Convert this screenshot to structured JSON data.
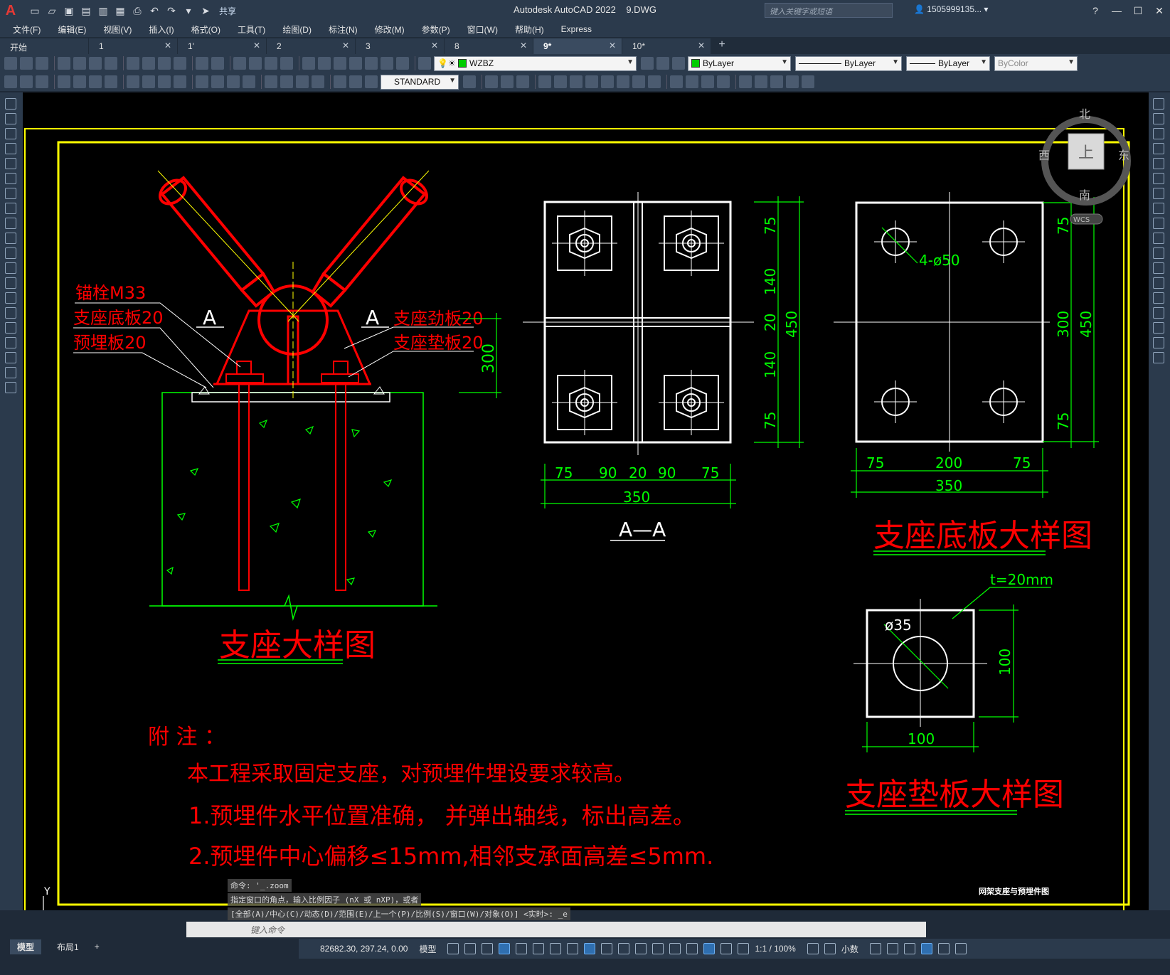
{
  "app": {
    "title": "Autodesk AutoCAD 2022",
    "file": "9.DWG",
    "share": "共享",
    "search_placeholder": "键入关键字或短语",
    "user": "1505999135...",
    "logo": "A"
  },
  "menu": [
    "文件(F)",
    "编辑(E)",
    "视图(V)",
    "插入(I)",
    "格式(O)",
    "工具(T)",
    "绘图(D)",
    "标注(N)",
    "修改(M)",
    "参数(P)",
    "窗口(W)",
    "帮助(H)",
    "Express"
  ],
  "tabs": [
    {
      "label": "开始",
      "active": false
    },
    {
      "label": "1",
      "active": false
    },
    {
      "label": "1'",
      "active": false
    },
    {
      "label": "2",
      "active": false
    },
    {
      "label": "3",
      "active": false
    },
    {
      "label": "8",
      "active": false
    },
    {
      "label": "9*",
      "active": true
    },
    {
      "label": "10*",
      "active": false
    }
  ],
  "toolbar": {
    "layer_name": "WZBZ",
    "color": "ByLayer",
    "linetype": "ByLayer",
    "lineweight": "ByLayer",
    "plotstyle": "ByColor",
    "textstyle": "STANDARD"
  },
  "viewcube": {
    "north": "北",
    "south": "南",
    "east": "东",
    "west": "西",
    "top": "上",
    "wcs": "WCS"
  },
  "drawing": {
    "support_labels": {
      "anchor": "锚栓M33",
      "base_plate": "支座底板20",
      "embedded_plate": "预埋板20",
      "stiffener": "支座劲板20",
      "pad_plate": "支座垫板20",
      "section_mark": "A",
      "height_dim": "300"
    },
    "support_title": "支座大样图",
    "section_aa": {
      "title": "A—A",
      "dims_vertical": [
        "75",
        "140",
        "20",
        "140",
        "75"
      ],
      "total_vertical": "450",
      "dims_horizontal": [
        "75",
        "90",
        "20",
        "90",
        "75"
      ],
      "total_horizontal": "350"
    },
    "base_plate_detail": {
      "title": "支座底板大样图",
      "hole_label": "4-ø50",
      "dims_vertical": [
        "75",
        "300",
        "75"
      ],
      "total_vertical": "450",
      "dims_horizontal": [
        "75",
        "200",
        "75"
      ],
      "total_horizontal": "350"
    },
    "pad_plate_detail": {
      "title": "支座垫板大样图",
      "thickness": "t=20mm",
      "hole": "ø35",
      "height": "100",
      "width": "100"
    },
    "notes": {
      "heading": "附 注 ：",
      "line0": "本工程采取固定支座，对预埋件埋设要求较高。",
      "line1": "1.预埋件水平位置准确， 并弹出轴线，标出高差。",
      "line2": "2.预埋件中心偏移≤15mm,相邻支承面高差≤5mm."
    },
    "sheet_name": "网架支座与预埋件图",
    "ucs_y": "Y"
  },
  "command": {
    "history": [
      "命令: '_.zoom",
      "指定窗口的角点，输入比例因子 (nX 或 nXP)，或者",
      "[全部(A)/中心(C)/动态(D)/范围(E)/上一个(P)/比例(S)/窗口(W)/对象(O)] <实时>: _e"
    ],
    "placeholder": "键入命令"
  },
  "layout_tabs": [
    "模型",
    "布局1",
    "+"
  ],
  "status": {
    "coords": "82682.30, 297.24, 0.00",
    "space": "模型",
    "scale": "1:1 / 100%",
    "units": "小数"
  }
}
